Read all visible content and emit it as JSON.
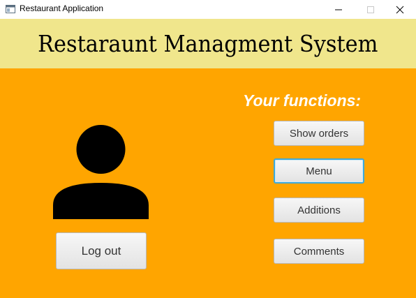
{
  "window": {
    "title": "Restaurant Application",
    "controls": [
      "minimize",
      "maximize",
      "close"
    ]
  },
  "header": {
    "title": "Restaraunt Managment System",
    "background": "#f0e68c"
  },
  "main": {
    "background": "#ffa500",
    "functions_title": "Your functions:",
    "buttons": [
      {
        "label": "Show orders",
        "focused": false
      },
      {
        "label": "Menu",
        "focused": true
      },
      {
        "label": "Additions",
        "focused": false
      },
      {
        "label": "Comments",
        "focused": false
      }
    ],
    "avatar_icon": "user-icon",
    "logout_label": "Log out"
  }
}
